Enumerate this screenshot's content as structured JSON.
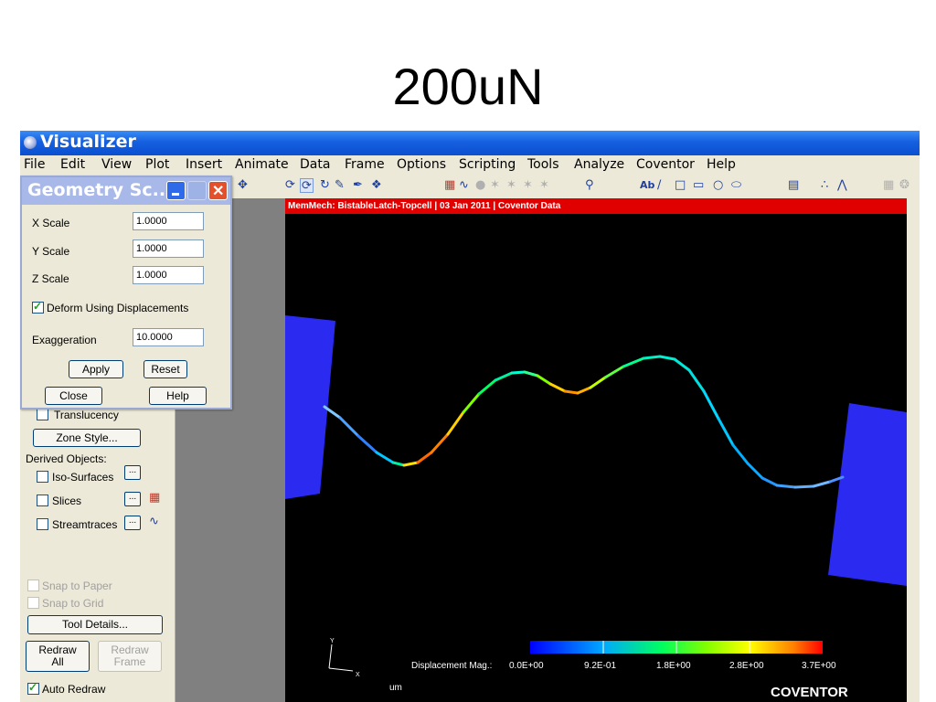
{
  "slide": {
    "title": "200uN"
  },
  "window": {
    "title": "Visualizer"
  },
  "menu": [
    "File",
    "Edit",
    "View",
    "Plot",
    "Insert",
    "Animate",
    "Data",
    "Frame",
    "Options",
    "Scripting",
    "Tools",
    "Analyze",
    "Coventor",
    "Help"
  ],
  "toolbar": {
    "text_tool": "Ab",
    "icons": [
      "translate-icon",
      "rotate-icon",
      "rotate-3d-icon",
      "probe-icon",
      "probe-adjust-icon",
      "slice-tool-icon",
      "streamtrace-icon",
      "contour-add-icon",
      "zoom-icon",
      "text-tool-icon",
      "line-tool-icon",
      "square-tool-icon",
      "rectangle-tool-icon",
      "circle-tool-icon",
      "ellipse-tool-icon",
      "frame-icon",
      "scatter-icon",
      "line-chart-icon",
      "grid-icon",
      "globe-icon"
    ]
  },
  "dialog": {
    "title": "Geometry Sc...",
    "x_scale_label": "X Scale",
    "x_scale_value": "1.0000",
    "y_scale_label": "Y Scale",
    "y_scale_value": "1.0000",
    "z_scale_label": "Z Scale",
    "z_scale_value": "1.0000",
    "deform_label": "Deform Using Displacements",
    "deform_checked": true,
    "exaggeration_label": "Exaggeration",
    "exaggeration_value": "10.0000",
    "apply": "Apply",
    "reset": "Reset",
    "close": "Close",
    "help": "Help"
  },
  "panel": {
    "translucency": "Translucency",
    "zone_style": "Zone Style...",
    "derived_objects": "Derived Objects:",
    "iso_surfaces": "Iso-Surfaces",
    "slices": "Slices",
    "streamtraces": "Streamtraces",
    "more": "...",
    "snap_paper": "Snap to Paper",
    "snap_grid": "Snap to Grid",
    "tool_details": "Tool Details...",
    "redraw_all_1": "Redraw",
    "redraw_all_2": "All",
    "redraw_frame_1": "Redraw",
    "redraw_frame_2": "Frame",
    "auto_redraw": "Auto Redraw",
    "auto_redraw_checked": true
  },
  "plot": {
    "header": "MemMech: BistableLatch-Topcell  |  03 Jan 2011  |  Coventor Data",
    "colorbar_label": "Displacement Mag.:",
    "colorbar_ticks": [
      "0.0E+00",
      "9.2E-01",
      "1.8E+00",
      "2.8E+00",
      "3.7E+00"
    ],
    "unit": "um",
    "axis_y": "Y",
    "axis_x": "X",
    "brand": "COVENTOR",
    "colors": {
      "background": "#000000",
      "anchor": "#2a2af0",
      "header": "#e00000"
    }
  }
}
